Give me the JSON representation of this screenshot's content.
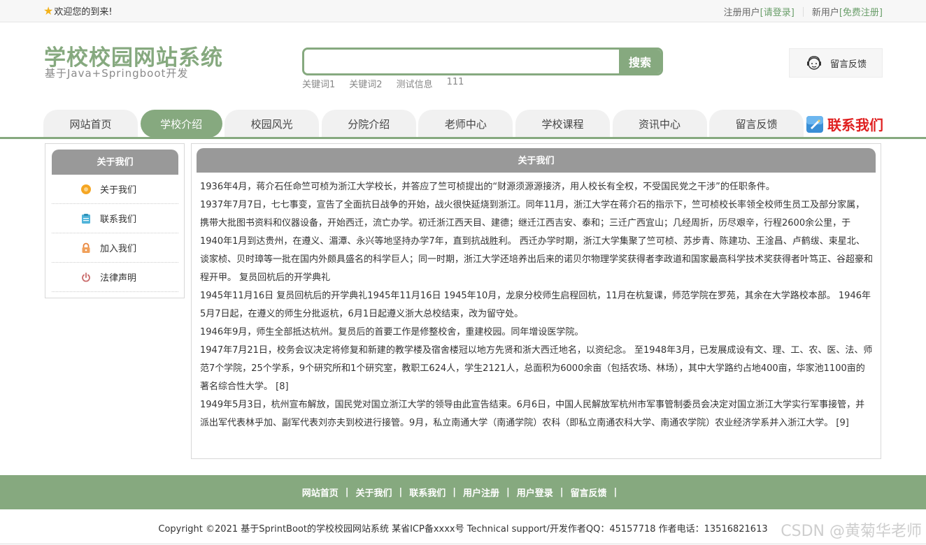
{
  "topbar": {
    "welcome": "欢迎您的到来!",
    "registered_label": "注册用户",
    "login_link": "[请登录]",
    "new_user_label": "新用户",
    "register_link": "[免费注册]"
  },
  "header": {
    "title": "学校校园网站系统",
    "subtitle": "基于Java+Springboot开发",
    "search_button": "搜索",
    "search_value": "",
    "keywords": [
      "关键词1",
      "关键词2",
      "测试信息",
      "111"
    ],
    "feedback_label": "留言反馈"
  },
  "nav": {
    "items": [
      "网站首页",
      "学校介绍",
      "校园风光",
      "分院介绍",
      "老师中心",
      "学校课程",
      "资讯中心",
      "留言反馈"
    ],
    "active": "学校介绍",
    "contact": "联系我们"
  },
  "sidebar": {
    "title": "关于我们",
    "items": [
      {
        "label": "关于我们",
        "icon": "orange-circle-icon"
      },
      {
        "label": "联系我们",
        "icon": "clipboard-icon"
      },
      {
        "label": "加入我们",
        "icon": "lock-icon"
      },
      {
        "label": "法律声明",
        "icon": "power-icon"
      }
    ]
  },
  "main": {
    "title": "关于我们",
    "paragraphs": [
      "1936年4月，蒋介石任命竺可桢为浙江大学校长，并答应了竺可桢提出的“财源须源源接济，用人校长有全权，不受国民党之干涉”的任职条件。",
      "1937年7月7日，七七事变，宣告了全面抗日战争的开始，战火很快延烧到浙江。同年11月，浙江大学在蒋介石的指示下，竺可桢校长率领全校师生员工及部分家属，携带大批图书资料和仪器设备，开始西迁，流亡办学。初迁浙江西天目、建德；继迁江西吉安、泰和；三迁广西宜山；几经周折，历尽艰辛，行程2600余公里，于1940年1月到达贵州，在遵义、湄潭、永兴等地坚持办学7年，直到抗战胜利。 西迁办学时期，浙江大学集聚了竺可桢、苏步青、陈建功、王淦昌、卢鹤绂、束星北、谈家桢、贝时璋等一批在国内外颇具盛名的科学巨人；同一时期，浙江大学还培养出后来的诺贝尔物理学奖获得者李政道和国家最高科学技术奖获得者叶笃正、谷超豪和程开甲。 复员回杭后的开学典礼",
      "1945年11月16日 复员回杭后的开学典礼1945年11月16日 1945年10月，龙泉分校师生启程回杭，11月在杭复课，师范学院在罗苑，其余在大学路校本部。 1946年5月7日起，在遵义的师生分批返杭，6月1日起遵义浙大总校结束，改为留守处。",
      "1946年9月，师生全部抵达杭州。复员后的首要工作是修整校舍，重建校园。同年增设医学院。",
      "1947年7月21日，校务会议决定将修复和新建的教学楼及宿舍楼冠以地方先贤和浙大西迁地名，以资纪念。 至1948年3月，已发展成设有文、理、工、农、医、法、师范7个学院，25个学系，9个研究所和1个研究室，教职工624人，学生2121人，总面积为6000余亩（包括农场、林场），其中大学路约占地400亩，华家池1100亩的著名综合性大学。 [8]",
      "1949年5月3日，杭州宣布解放，国民党对国立浙江大学的领导由此宣告结束。6月6日，中国人民解放军杭州市军事管制委员会决定对国立浙江大学实行军事接管，并派出军代表林乎加、副军代表刘亦夫到校进行接管。9月，私立南通大学（南通学院）农科（即私立南通农科大学、南通农学院）农业经济学系并入浙江大学。 [9]"
    ]
  },
  "footer": {
    "links": [
      "网站首页",
      "关于我们",
      "联系我们",
      "用户注册",
      "用户登录",
      "留言反馈"
    ],
    "copyright": "Copyright ©2021 基于SprintBoot的学校校园网站系统    某省ICP备xxxx号    Technical support/开发作者QQ：45157718    作者电话：13516821613",
    "watermark": "CSDN @黄菊华老师"
  },
  "colors": {
    "accent": "#86a97f",
    "panel_header": "#999999",
    "contact": "#e02020"
  }
}
